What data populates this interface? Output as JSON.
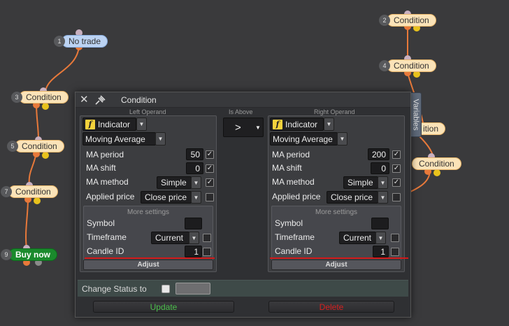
{
  "graph": {
    "nodes": [
      {
        "num": "1",
        "label": "No trade"
      },
      {
        "num": "2",
        "label": "Condition"
      },
      {
        "num": "3",
        "label": "Condition"
      },
      {
        "num": "4",
        "label": "Condition"
      },
      {
        "num": "5",
        "label": "Condition"
      },
      {
        "num": "7",
        "label": "Condition"
      },
      {
        "num": "",
        "label": "Condition"
      },
      {
        "num": "9",
        "label": "Buy now"
      }
    ],
    "partial_node_label": "ition"
  },
  "dialog": {
    "title": "Condition",
    "left": {
      "header": "Left Operand",
      "type_label": "Indicator",
      "indicator_name": "Moving Average",
      "params": [
        {
          "label": "MA period",
          "value": "50",
          "checked": true
        },
        {
          "label": "MA shift",
          "value": "0",
          "checked": true
        },
        {
          "label": "MA method",
          "value": "Simple",
          "checked": true
        },
        {
          "label": "Applied price",
          "value": "Close price",
          "checked": false
        }
      ],
      "more_settings": {
        "header": "More settings",
        "rows": [
          {
            "label": "Symbol",
            "value": ""
          },
          {
            "label": "Timeframe",
            "value": "Current"
          },
          {
            "label": "Candle ID",
            "value": "1"
          }
        ]
      },
      "adjust_label": "Adjust"
    },
    "operator": {
      "header": "Is Above",
      "symbol": ">"
    },
    "right": {
      "header": "Right Operand",
      "type_label": "Indicator",
      "indicator_name": "Moving Average",
      "params": [
        {
          "label": "MA period",
          "value": "200",
          "checked": true
        },
        {
          "label": "MA shift",
          "value": "0",
          "checked": true
        },
        {
          "label": "MA method",
          "value": "Simple",
          "checked": true
        },
        {
          "label": "Applied price",
          "value": "Close price",
          "checked": false
        }
      ],
      "more_settings": {
        "header": "More settings",
        "rows": [
          {
            "label": "Symbol",
            "value": ""
          },
          {
            "label": "Timeframe",
            "value": "Current"
          },
          {
            "label": "Candle ID",
            "value": "1"
          }
        ]
      },
      "adjust_label": "Adjust"
    },
    "change_status_label": "Change Status to",
    "update_label": "Update",
    "delete_label": "Delete",
    "variables_tab": "Variables"
  },
  "colors": {
    "condition_node": "#fbe3b8",
    "no_trade_node": "#bcd3f3",
    "buy_now_node": "#1a8a2c",
    "link": "#e8793a",
    "highlight_line": "#d21818",
    "update_text": "#4cbf4c",
    "delete_text": "#d52020"
  }
}
